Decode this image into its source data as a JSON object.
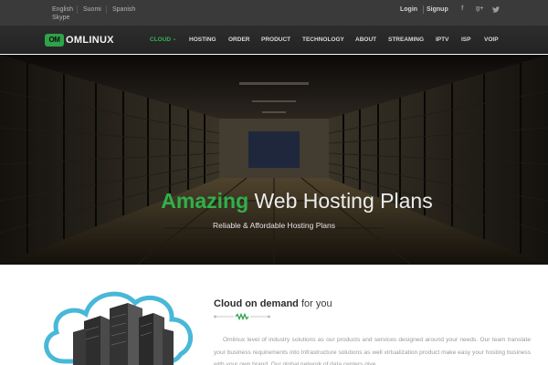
{
  "topbar": {
    "languages": [
      "English",
      "Suomi",
      "Spanish",
      "Skype"
    ],
    "login_label": "Login",
    "signup_label": "Signup",
    "social": {
      "facebook": "f",
      "google_plus": "g+",
      "twitter": "twitter-icon"
    }
  },
  "brand": {
    "badge_text": "OM",
    "name": "OMLINUX",
    "accent_color": "#2fa24a"
  },
  "nav": {
    "items": [
      "CLOUD",
      "HOSTING",
      "ORDER",
      "PRODUCT",
      "TECHNOLOGY",
      "ABOUT",
      "STREAMING",
      "IPTV",
      "ISP",
      "VOIP"
    ],
    "active": "CLOUD"
  },
  "hero": {
    "title_accent": "Amazing",
    "title_rest": " Web Hosting Plans",
    "subtitle": "Reliable & Affordable Hosting Plans"
  },
  "section": {
    "title_bold": "Cloud on demand",
    "title_rest": " for you",
    "paragraph": "Omlinux level of industry solutions as our products and services designed around your needs. Our team translate your business requirements into Infrastructure solutions as well virtualization product make easy your hosting business with your own brand. Our global network of data centers give"
  }
}
